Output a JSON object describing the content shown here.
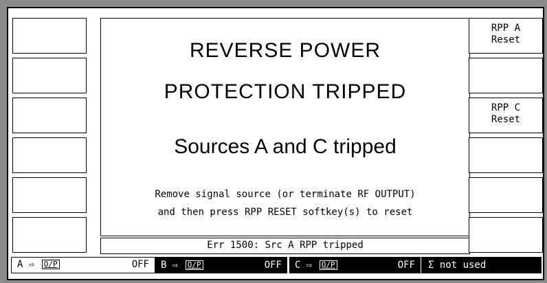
{
  "main": {
    "title_line1": "REVERSE POWER",
    "title_line2": "PROTECTION TRIPPED",
    "sources_line": "Sources A and C tripped",
    "message_line1": "Remove signal source (or terminate RF OUTPUT)",
    "message_line2": "and then press RPP RESET softkey(s) to reset"
  },
  "error_bar": "Err 1500: Src A RPP tripped",
  "right_softkeys": {
    "rpp_a_line1": "RPP A",
    "rpp_a_line2": "Reset",
    "rpp_c_line1": "RPP C",
    "rpp_c_line2": "Reset"
  },
  "status": {
    "a_label": "A ⇨",
    "b_label": "B ⇨",
    "c_label": "C ⇨",
    "op_label": "O/P",
    "a_state": "OFF",
    "b_state": "OFF",
    "c_state": "OFF",
    "sigma_text": "Σ not used"
  },
  "colors": {
    "background": "#8c8c8c",
    "screen": "#ffffff",
    "ink": "#000000"
  }
}
